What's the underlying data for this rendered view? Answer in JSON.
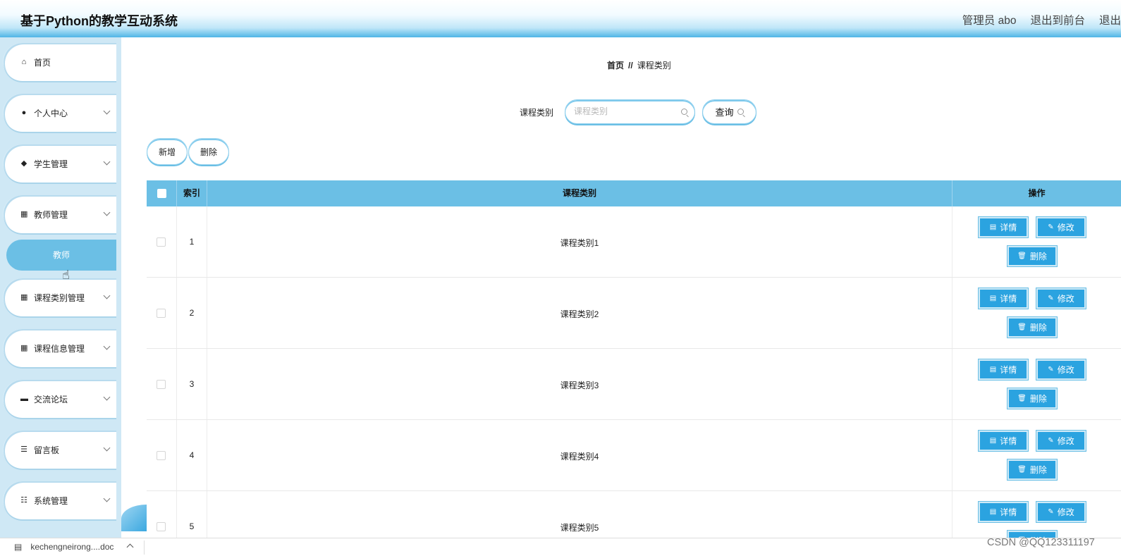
{
  "app": {
    "title": "基于Python的教学互动系统",
    "top_links": [
      "管理员 abo",
      "退出到前台",
      "退出"
    ]
  },
  "sidebar": {
    "items": [
      {
        "label": "首页",
        "icon": "home-icon",
        "expandable": false
      },
      {
        "label": "个人中心",
        "icon": "user-icon",
        "expandable": true
      },
      {
        "label": "学生管理",
        "icon": "location-pin-icon",
        "expandable": true
      },
      {
        "label": "教师管理",
        "icon": "grid-icon",
        "expandable": true
      },
      {
        "label": "课程类别管理",
        "icon": "grid-icon",
        "expandable": true
      },
      {
        "label": "课程信息管理",
        "icon": "grid-icon",
        "expandable": true
      },
      {
        "label": "交流论坛",
        "icon": "briefcase-icon",
        "expandable": true
      },
      {
        "label": "留言板",
        "icon": "list-icon",
        "expandable": true
      },
      {
        "label": "系统管理",
        "icon": "sliders-icon",
        "expandable": true
      }
    ],
    "active_sub_item": "教师"
  },
  "breadcrumb": {
    "home": "首页",
    "separator": "//",
    "current": "课程类别"
  },
  "search": {
    "label": "课程类别",
    "placeholder": "课程类别",
    "button_label": "查询"
  },
  "toolbar": {
    "add_label": "新增",
    "delete_label": "删除"
  },
  "table": {
    "headers": {
      "index": "索引",
      "category": "课程类别",
      "actions": "操作"
    },
    "rows": [
      {
        "index": "1",
        "category": "课程类别1"
      },
      {
        "index": "2",
        "category": "课程类别2"
      },
      {
        "index": "3",
        "category": "课程类别3"
      },
      {
        "index": "4",
        "category": "课程类别4"
      },
      {
        "index": "5",
        "category": "课程类别5"
      }
    ],
    "row_actions": {
      "detail": "详情",
      "edit": "修改",
      "delete": "删除"
    }
  },
  "download_bar": {
    "filename": "kechengneirong....doc"
  },
  "watermark": "CSDN @QQ123311197",
  "colors": {
    "accent": "#6bbfe5",
    "button": "#2ba3e0",
    "sidebar_bg": "#cfe8f5"
  }
}
